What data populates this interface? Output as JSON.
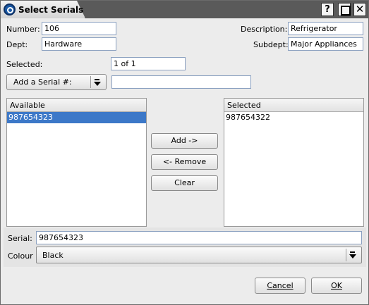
{
  "window": {
    "title": "Select Serials"
  },
  "titlebar": {
    "help": "?",
    "close": "✕"
  },
  "form": {
    "number_label": "Number:",
    "number_value": "106",
    "dept_label": "Dept:",
    "dept_value": "Hardware",
    "description_label": "Description:",
    "description_value": "Refrigerator",
    "subdept_label": "Subdept:",
    "subdept_value": "Major Appliances",
    "selected_label": "Selected:",
    "selected_value": "1 of 1",
    "add_serial_label": "Add a Serial #:",
    "add_serial_value": ""
  },
  "available": {
    "header": "Available",
    "items": [
      "987654323"
    ]
  },
  "selected_list": {
    "header": "Selected",
    "items": [
      "987654322"
    ]
  },
  "actions": {
    "add": "Add ->",
    "remove": "<- Remove",
    "clear": "Clear"
  },
  "bottom": {
    "serial_label": "Serial:",
    "serial_value": "987654323",
    "colour_label": "Colour",
    "colour_value": "Black"
  },
  "footer": {
    "cancel": "Cancel",
    "ok": "OK"
  }
}
